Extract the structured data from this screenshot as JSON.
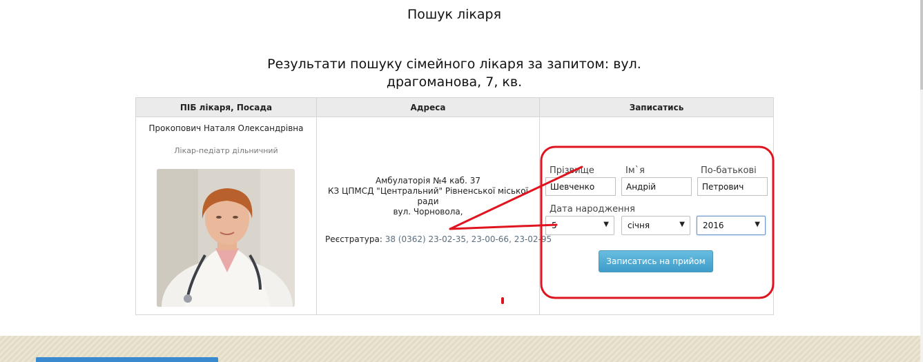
{
  "page": {
    "title": "Пошук лікаря",
    "results_heading_line1": "Результати пошуку сімейного лікаря за запитом: вул.",
    "results_heading_line2": "драгоманова, 7, кв."
  },
  "table": {
    "headers": [
      "ПІБ лікаря, Посада",
      "Адреса",
      "Записатись"
    ],
    "doctor": {
      "name": "Прокопович Наталя Олександрівна",
      "position": "Лікар-педіатр дільничний"
    },
    "address": {
      "lines": [
        "Амбулаторія №4 каб. 37",
        "КЗ ЦПМСД \"Центральний\" Рівненської міської",
        "ради",
        "вул. Чорновола,"
      ],
      "registry_label": "Реєстратура:",
      "registry_phones": "38 (0362) 23-02-35, 23-00-66, 23-02-95"
    }
  },
  "signup_form": {
    "surname_label": "Прізвище",
    "surname_value": "Шевченко",
    "name_label": "Ім`я",
    "name_value": "Андрій",
    "patronymic_label": "По-батькові",
    "patronymic_value": "Петрович",
    "birthdate_label": "Дата народження",
    "day_selected": "5",
    "month_selected": "січня",
    "year_selected": "2016",
    "submit_label": "Записатись на прийом"
  },
  "colors": {
    "annotation_red": "#e0141e",
    "button_blue": "#4fa9d4",
    "footer_blue": "#3a8ad0"
  }
}
